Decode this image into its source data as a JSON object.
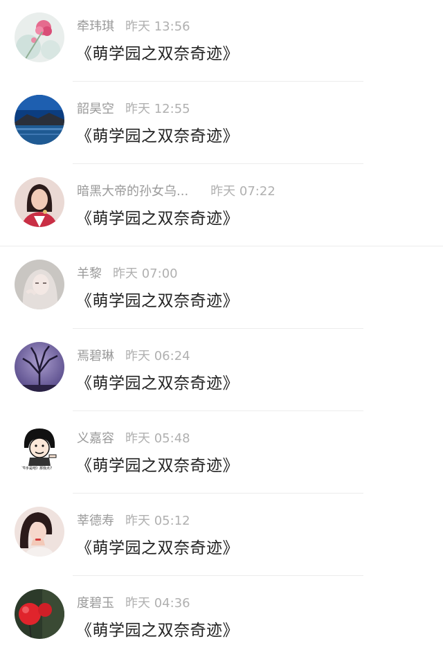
{
  "comments": [
    {
      "name": "牵玮琪",
      "time": "昨天 13:56",
      "text": "《萌学园之双奈奇迹》",
      "avatar": "flower-avatar"
    },
    {
      "name": "韶昊空",
      "time": "昨天 12:55",
      "text": "《萌学园之双奈奇迹》",
      "avatar": "lake-avatar"
    },
    {
      "name": "暗黑大帝的孙女乌...",
      "time": "昨天 07:22",
      "text": "《萌学园之双奈奇迹》",
      "avatar": "woman-avatar"
    },
    {
      "name": "羊黎",
      "time": "昨天 07:00",
      "text": "《萌学园之双奈奇迹》",
      "avatar": "blonde-girl-avatar"
    },
    {
      "name": "焉碧琳",
      "time": "昨天 06:24",
      "text": "《萌学园之双奈奇迹》",
      "avatar": "tree-avatar"
    },
    {
      "name": "义嘉容",
      "time": "昨天 05:48",
      "text": "《萌学园之双奈奇迹》",
      "avatar": "meme-avatar",
      "avatar_caption": "《举手是吧》那我点7"
    },
    {
      "name": "莘德寿",
      "time": "昨天 05:12",
      "text": "《萌学园之双奈奇迹》",
      "avatar": "girl-avatar"
    },
    {
      "name": "度碧玉",
      "time": "昨天 04:36",
      "text": "《萌学园之双奈奇迹》",
      "avatar": "red-balloon-avatar"
    }
  ]
}
